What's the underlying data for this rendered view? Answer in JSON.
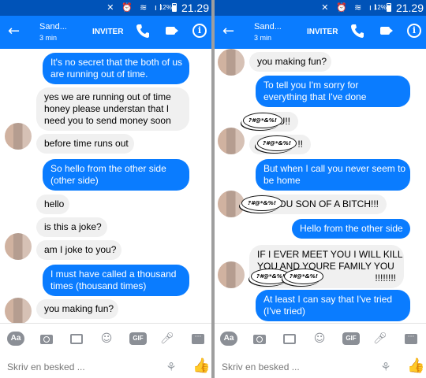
{
  "status": {
    "battery": "12%",
    "time": "21.29",
    "icons": [
      "mute-icon",
      "alarm-icon",
      "wifi-icon",
      "signal-icon"
    ]
  },
  "header": {
    "back_icon": "←",
    "contact": "Sand...",
    "last_active": "3 min",
    "invite": "INVITER",
    "info_icon": "i"
  },
  "colors": {
    "header": "#0a7cff",
    "statusbar": "#0053b8",
    "outgoing": "#0a7cff",
    "incoming": "#f0f0f0"
  },
  "curse_word": "?#@*&%!",
  "panels": [
    {
      "messages": [
        {
          "dir": "out",
          "lines": [
            "It's no secret that the both of us",
            "are running out of time."
          ]
        },
        {
          "dir": "in",
          "lines": [
            "yes we are running out of time",
            "honey please understan that I",
            "need you to send money soon"
          ]
        },
        {
          "dir": "in",
          "lines": [
            "before time runs out"
          ]
        },
        {
          "dir": "out",
          "lines": [
            "So hello from the other side",
            "(other side)"
          ]
        },
        {
          "dir": "in",
          "lines": [
            "hello"
          ]
        },
        {
          "dir": "in",
          "lines": [
            "is this a joke?"
          ]
        },
        {
          "dir": "in",
          "lines": [
            "am I joke to you?"
          ]
        },
        {
          "dir": "out",
          "lines": [
            "I must have called a thousand",
            "times (thousand times)"
          ]
        },
        {
          "dir": "in",
          "lines": [
            "you making fun?"
          ]
        }
      ]
    },
    {
      "messages": [
        {
          "dir": "in",
          "lines": [
            "you making fun?"
          ]
        },
        {
          "dir": "out",
          "lines": [
            "To tell you I'm sorry for",
            "everything that I've done"
          ]
        },
        {
          "dir": "in",
          "lines": [
            "U!!"
          ]
        },
        {
          "dir": "in",
          "lines": [
            "!!"
          ]
        },
        {
          "dir": "out",
          "lines": [
            "But when I call you never seem to",
            "be home"
          ]
        },
        {
          "dir": "in",
          "lines": [
            "YOU SON OF A BITCH!!!"
          ]
        },
        {
          "dir": "out",
          "lines": [
            "Hello from the other side"
          ]
        },
        {
          "dir": "in",
          "lines": [
            "IF I EVER MEET YOU I WILL KILL",
            "YOU AND YOURE FAMILY YOU",
            "!!!!!!!!"
          ]
        },
        {
          "dir": "out",
          "lines": [
            "At least I can say that I've tried",
            "(I've tried)"
          ]
        }
      ]
    }
  ],
  "composer": {
    "placeholder": "Skriv en besked ...",
    "aa_label": "Aa",
    "gif_label": "GIF",
    "tools": [
      "aa-icon",
      "camera-icon",
      "image-icon",
      "emoji-icon",
      "gif-icon",
      "microphone-icon",
      "more-icon"
    ],
    "sticker_icon": "⚘",
    "like_icon": "👍"
  }
}
